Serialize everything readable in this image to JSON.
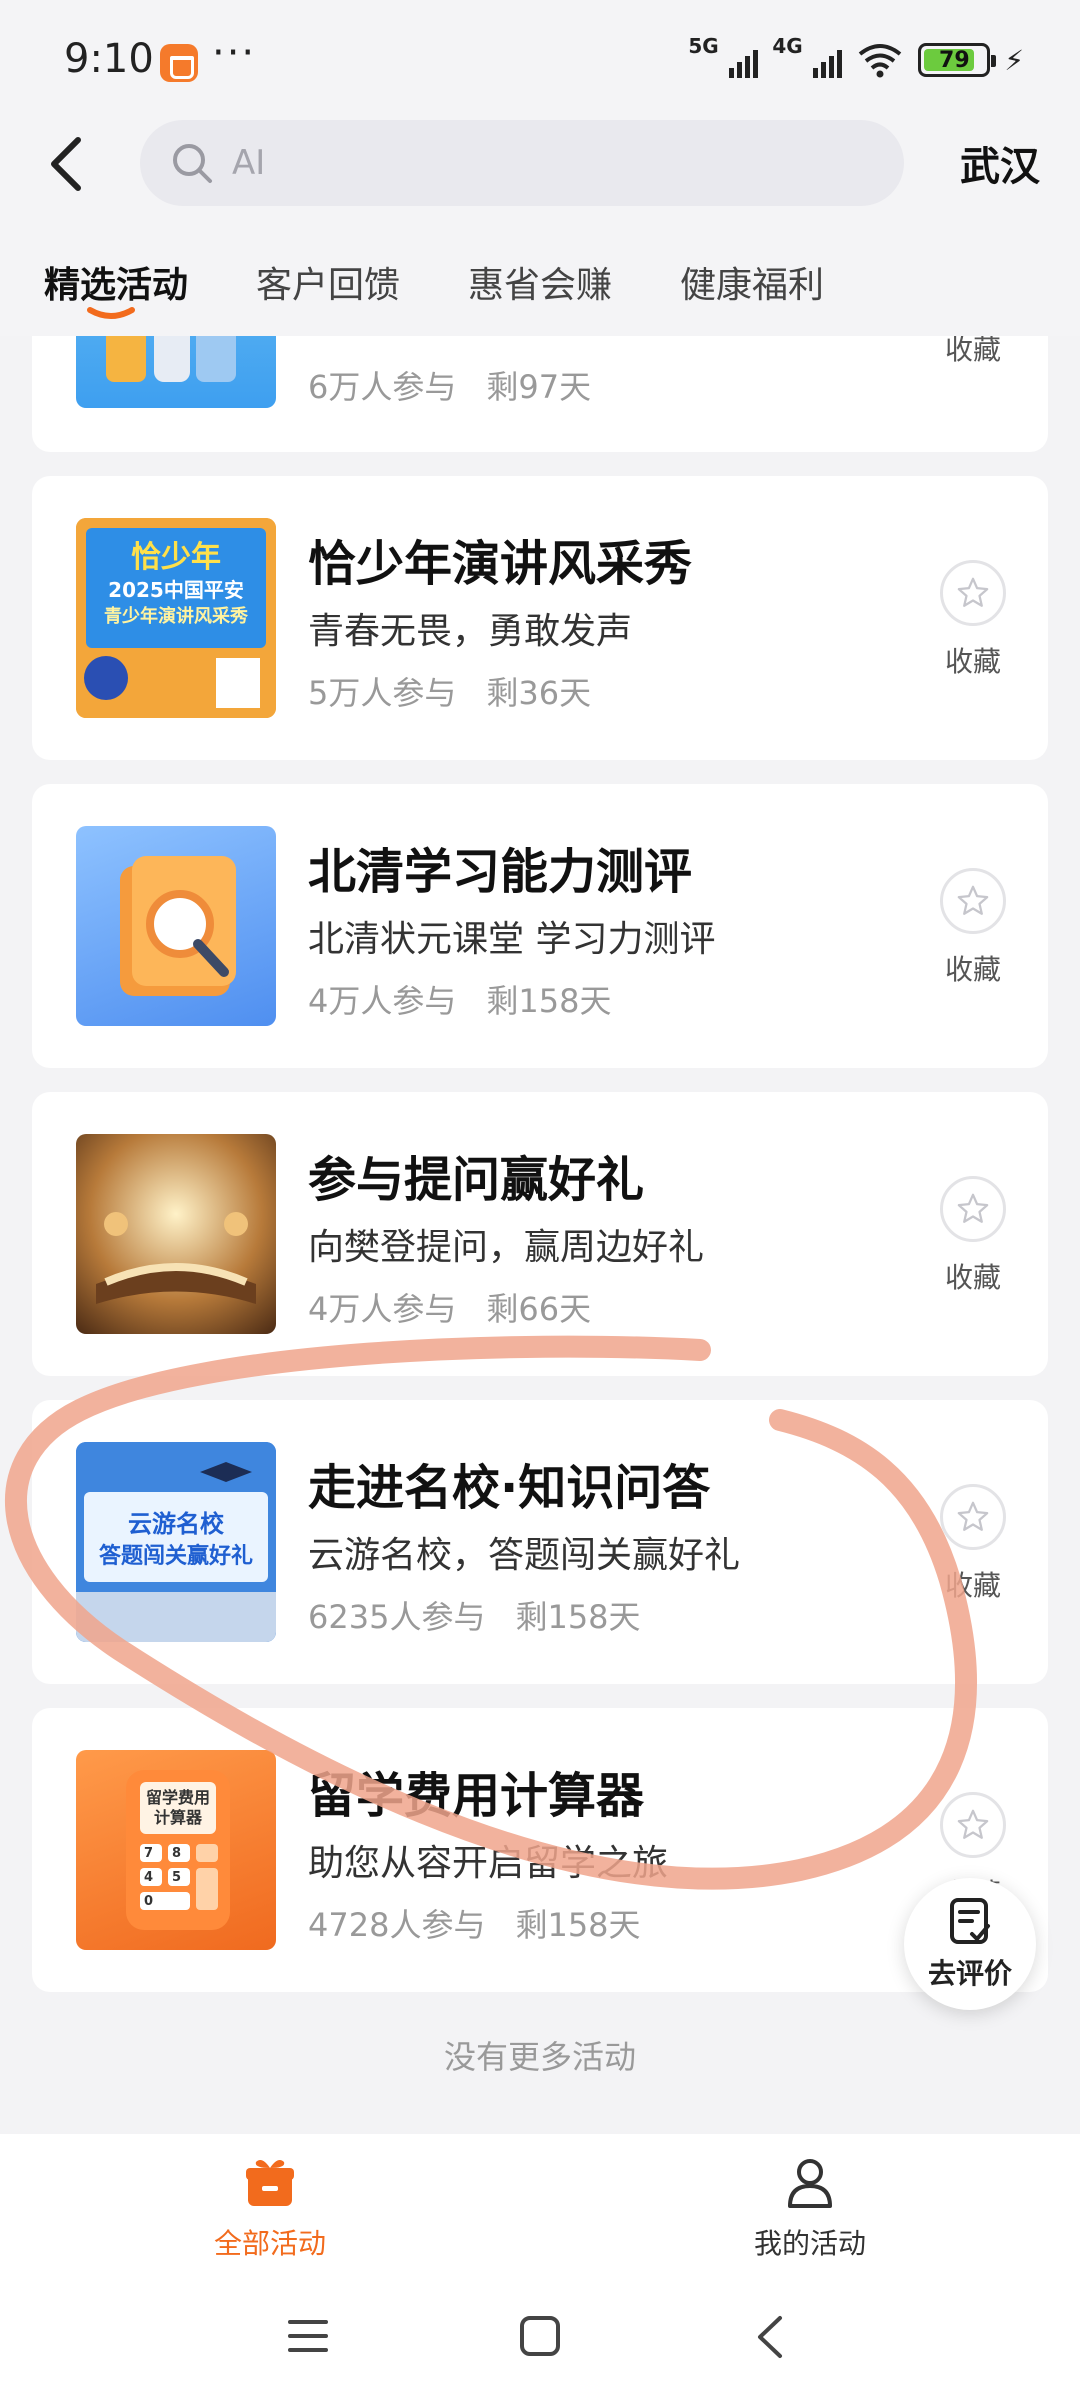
{
  "status_bar": {
    "time": "9:10",
    "dots": "···",
    "sig1": "5G",
    "sig2": "4G",
    "battery": "79"
  },
  "header": {
    "search_placeholder": "AI",
    "city": "武汉"
  },
  "tabs": [
    {
      "label": "精选活动",
      "active": true
    },
    {
      "label": "客户回馈",
      "active": false
    },
    {
      "label": "惠省会赚",
      "active": false
    },
    {
      "label": "健康福利",
      "active": false
    }
  ],
  "cards": [
    {
      "title": "",
      "desc": "",
      "participants": "6万人参与",
      "remaining": "剩97天",
      "fav_label": "收藏"
    },
    {
      "title": "恰少年演讲风采秀",
      "desc": "青春无畏，勇敢发声",
      "participants": "5万人参与",
      "remaining": "剩36天",
      "fav_label": "收藏"
    },
    {
      "title": "北清学习能力测评",
      "desc": "北清状元课堂 学习力测评",
      "participants": "4万人参与",
      "remaining": "剩158天",
      "fav_label": "收藏"
    },
    {
      "title": "参与提问赢好礼",
      "desc": "向樊登提问，赢周边好礼",
      "participants": "4万人参与",
      "remaining": "剩66天",
      "fav_label": "收藏"
    },
    {
      "title": "走进名校·知识问答",
      "desc": "云游名校，答题闯关赢好礼",
      "participants": "6235人参与",
      "remaining": "剩158天",
      "fav_label": "收藏"
    },
    {
      "title": "留学费用计算器",
      "desc": "助您从容开启留学之旅",
      "participants": "4728人参与",
      "remaining": "剩158天",
      "fav_label": "收藏"
    }
  ],
  "thumbs": {
    "t2_line1": "恰少年",
    "t2_line2": "2025中国平安",
    "t2_line3": "青少年演讲风采秀",
    "t5_line1": "云游名校",
    "t5_line2": "答题闯关赢好礼",
    "t6_line1": "留学费用",
    "t6_line2": "计算器",
    "t6_keys": [
      "7",
      "8",
      "4",
      "5",
      "0"
    ]
  },
  "review_fab": "去评价",
  "no_more": "没有更多活动",
  "bottom_nav": [
    {
      "label": "全部活动",
      "active": true
    },
    {
      "label": "我的活动",
      "active": false
    }
  ],
  "colors": {
    "accent": "#f26b1d",
    "annotation": "#f0a58c"
  }
}
